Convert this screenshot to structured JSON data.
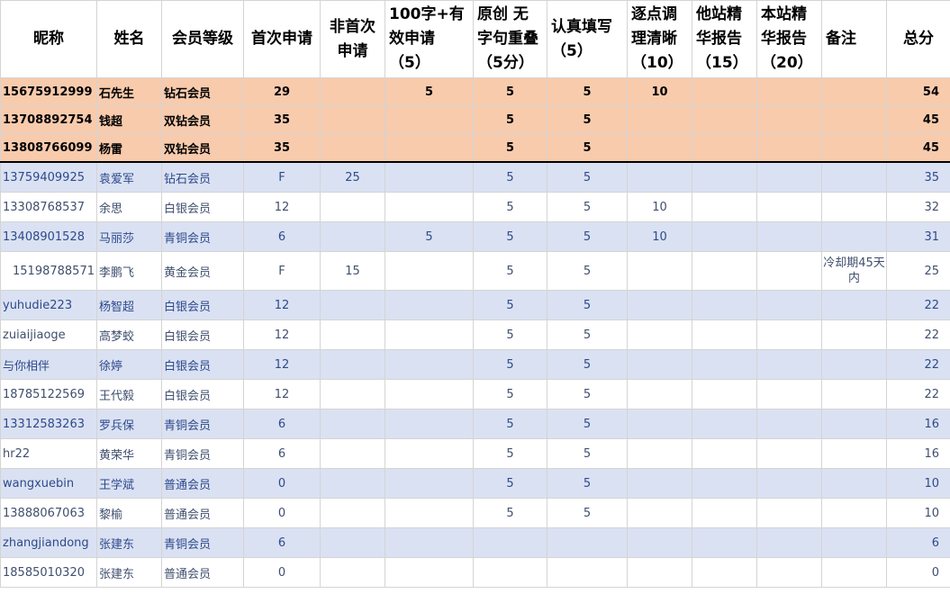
{
  "headers": {
    "nickname": "昵称",
    "name": "姓名",
    "level": "会员等级",
    "first": "首次申请",
    "nonfirst_a": "非首次",
    "nonfirst_b": "申请",
    "valid_a": "100字+有",
    "valid_b": "效申请",
    "valid_c": "（5）",
    "orig_a": "原创 无",
    "orig_b": "字句重叠",
    "orig_c": "（5分）",
    "care_a": "认真填写",
    "care_b": "（5）",
    "point_a": "逐点调",
    "point_b": "理清晰",
    "point_c": "（10）",
    "other_a": "他站精",
    "other_b": "华报告",
    "other_c": "（15）",
    "site_a": "本站精",
    "site_b": "华报告",
    "site_c": "（20）",
    "note": "备注",
    "total": "总分"
  },
  "rows": [
    {
      "nick": "15675912999",
      "name": "石先生",
      "level": "钻石会员",
      "first": "29",
      "nonfirst": "",
      "valid": "5",
      "orig": "5",
      "care": "5",
      "point": "10",
      "other": "",
      "site": "",
      "note": "",
      "total": "54"
    },
    {
      "nick": "13708892754",
      "name": "钱超",
      "level": "双钻会员",
      "first": "35",
      "nonfirst": "",
      "valid": "",
      "orig": "5",
      "care": "5",
      "point": "",
      "other": "",
      "site": "",
      "note": "",
      "total": "45"
    },
    {
      "nick": "13808766099",
      "name": "杨雷",
      "level": "双钻会员",
      "first": "35",
      "nonfirst": "",
      "valid": "",
      "orig": "5",
      "care": "5",
      "point": "",
      "other": "",
      "site": "",
      "note": "",
      "total": "45"
    },
    {
      "nick": "13759409925",
      "name": "袁爱军",
      "level": "钻石会员",
      "first": "F",
      "nonfirst": "25",
      "valid": "",
      "orig": "5",
      "care": "5",
      "point": "",
      "other": "",
      "site": "",
      "note": "",
      "total": "35"
    },
    {
      "nick": "13308768537",
      "name": "余思",
      "level": "白银会员",
      "first": "12",
      "nonfirst": "",
      "valid": "",
      "orig": "5",
      "care": "5",
      "point": "10",
      "other": "",
      "site": "",
      "note": "",
      "total": "32"
    },
    {
      "nick": "13408901528",
      "name": "马丽莎",
      "level": "青铜会员",
      "first": "6",
      "nonfirst": "",
      "valid": "5",
      "orig": "5",
      "care": "5",
      "point": "10",
      "other": "",
      "site": "",
      "note": "",
      "total": "31"
    },
    {
      "nick": "15198788571",
      "name": "李鹏飞",
      "level": "黄金会员",
      "first": "F",
      "nonfirst": "15",
      "valid": "",
      "orig": "5",
      "care": "5",
      "point": "",
      "other": "",
      "site": "",
      "note": "冷却期45天内",
      "total": "25"
    },
    {
      "nick": "yuhudie223",
      "name": "杨智超",
      "level": "白银会员",
      "first": "12",
      "nonfirst": "",
      "valid": "",
      "orig": "5",
      "care": "5",
      "point": "",
      "other": "",
      "site": "",
      "note": "",
      "total": "22"
    },
    {
      "nick": "zuiaijiaoge",
      "name": "高梦蛟",
      "level": "白银会员",
      "first": "12",
      "nonfirst": "",
      "valid": "",
      "orig": "5",
      "care": "5",
      "point": "",
      "other": "",
      "site": "",
      "note": "",
      "total": "22"
    },
    {
      "nick": "与你相伴",
      "name": "徐婷",
      "level": "白银会员",
      "first": "12",
      "nonfirst": "",
      "valid": "",
      "orig": "5",
      "care": "5",
      "point": "",
      "other": "",
      "site": "",
      "note": "",
      "total": "22"
    },
    {
      "nick": "18785122569",
      "name": "王代毅",
      "level": "白银会员",
      "first": "12",
      "nonfirst": "",
      "valid": "",
      "orig": "5",
      "care": "5",
      "point": "",
      "other": "",
      "site": "",
      "note": "",
      "total": "22"
    },
    {
      "nick": "13312583263",
      "name": "罗兵保",
      "level": "青铜会员",
      "first": "6",
      "nonfirst": "",
      "valid": "",
      "orig": "5",
      "care": "5",
      "point": "",
      "other": "",
      "site": "",
      "note": "",
      "total": "16"
    },
    {
      "nick": "hr22",
      "name": "黄荣华",
      "level": "青铜会员",
      "first": "6",
      "nonfirst": "",
      "valid": "",
      "orig": "5",
      "care": "5",
      "point": "",
      "other": "",
      "site": "",
      "note": "",
      "total": "16"
    },
    {
      "nick": "wangxuebin",
      "name": "王学斌",
      "level": "普通会员",
      "first": "0",
      "nonfirst": "",
      "valid": "",
      "orig": "5",
      "care": "5",
      "point": "",
      "other": "",
      "site": "",
      "note": "",
      "total": "10"
    },
    {
      "nick": "13888067063",
      "name": "黎榆",
      "level": "普通会员",
      "first": "0",
      "nonfirst": "",
      "valid": "",
      "orig": "5",
      "care": "5",
      "point": "",
      "other": "",
      "site": "",
      "note": "",
      "total": "10"
    },
    {
      "nick": "zhangjiandong",
      "name": "张建东",
      "level": "青铜会员",
      "first": "6",
      "nonfirst": "",
      "valid": "",
      "orig": "",
      "care": "",
      "point": "",
      "other": "",
      "site": "",
      "note": "",
      "total": "6"
    },
    {
      "nick": "18585010320",
      "name": "张建东",
      "level": "普通会员",
      "first": "0",
      "nonfirst": "",
      "valid": "",
      "orig": "",
      "care": "",
      "point": "",
      "other": "",
      "site": "",
      "note": "",
      "total": "0"
    }
  ]
}
